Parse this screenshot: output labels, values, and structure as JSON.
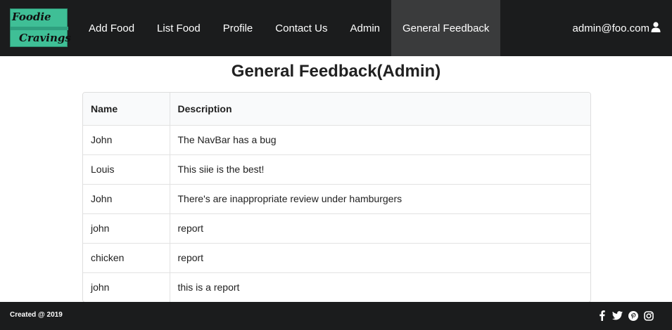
{
  "brand": {
    "line1": "Foodie",
    "line2": "Cravings"
  },
  "nav": {
    "items": [
      {
        "label": "Add Food"
      },
      {
        "label": "List Food"
      },
      {
        "label": "Profile"
      },
      {
        "label": "Contact Us"
      },
      {
        "label": "Admin"
      },
      {
        "label": "General Feedback",
        "active": true
      }
    ],
    "user_email": "admin@foo.com",
    "user_icon": "user-icon"
  },
  "page": {
    "title": "General Feedback(Admin)"
  },
  "table": {
    "headers": [
      "Name",
      "Description"
    ],
    "rows": [
      [
        "John",
        "The NavBar has a bug"
      ],
      [
        "Louis",
        "This siie is the best!"
      ],
      [
        "John",
        "There's are inappropriate review under hamburgers"
      ],
      [
        "john",
        "report"
      ],
      [
        "chicken",
        "report"
      ],
      [
        "john",
        "this is a report"
      ]
    ]
  },
  "footer": {
    "created": "Created @ 2019",
    "social_icons": [
      "facebook-icon",
      "twitter-icon",
      "pinterest-icon",
      "instagram-icon"
    ]
  },
  "colors": {
    "navbar": "#1b1c1d",
    "active_tab": "#3a3b3c",
    "logo_bg": "#3fbf96"
  }
}
